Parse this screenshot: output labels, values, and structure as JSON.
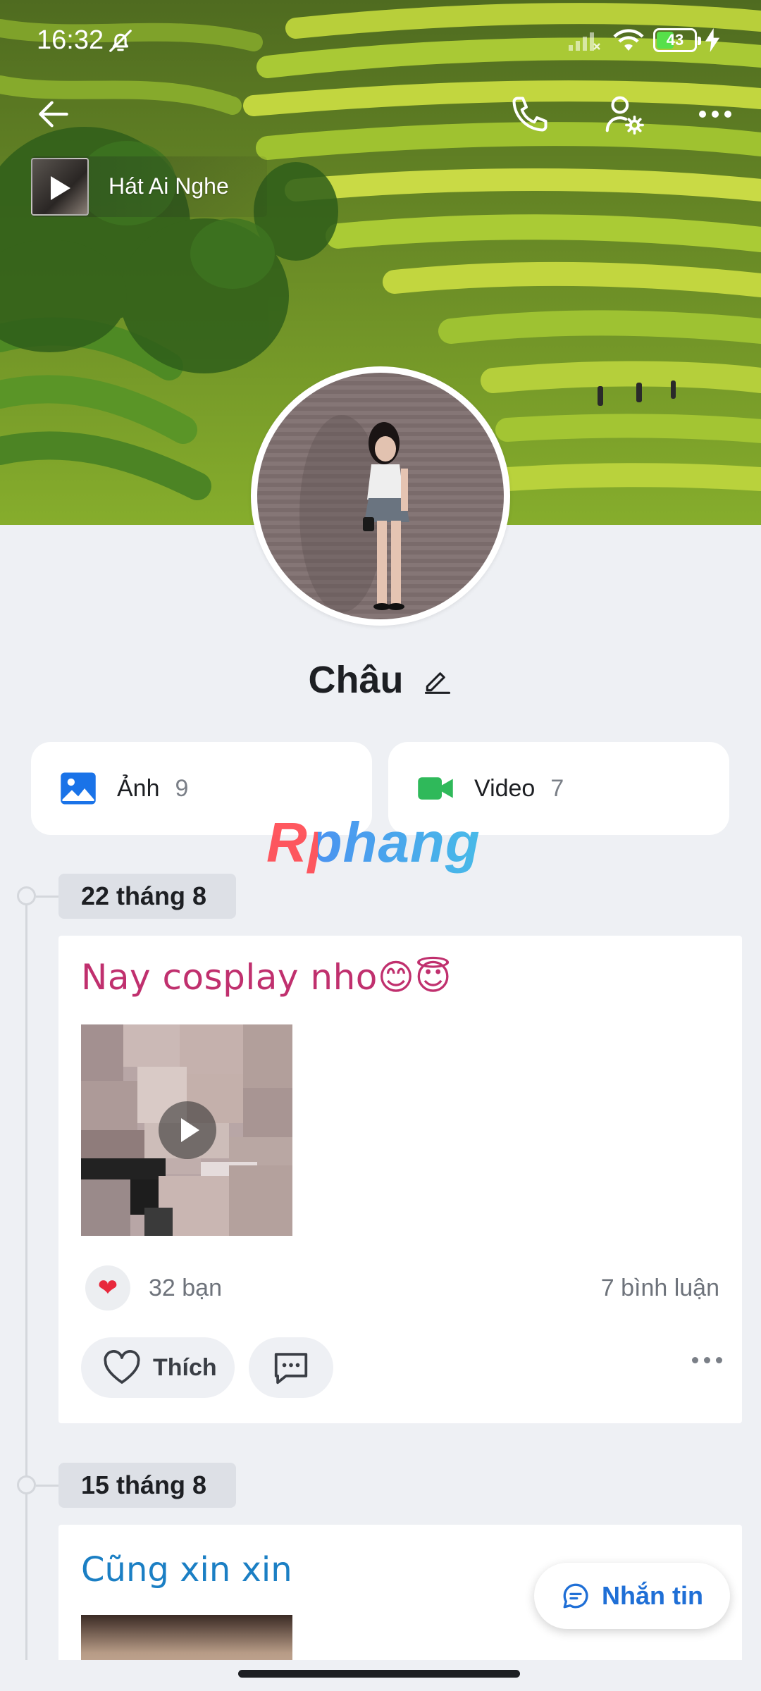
{
  "status_bar": {
    "time": "16:32",
    "battery_level": "43",
    "icons": [
      "bell-off-icon",
      "signal-icon",
      "wifi-icon",
      "battery-icon",
      "charging-icon"
    ]
  },
  "header": {
    "icons": [
      "back-arrow-icon",
      "phone-icon",
      "user-settings-icon",
      "more-horizontal-icon"
    ]
  },
  "music": {
    "title": "Hát Ai Nghe",
    "icon": "play-icon"
  },
  "profile": {
    "name": "Châu",
    "edit_icon": "pencil-icon"
  },
  "media": {
    "photos_label": "Ảnh",
    "photos_count": "9",
    "videos_label": "Video",
    "videos_count": "7"
  },
  "watermark": "Rphang",
  "timeline": [
    {
      "date": "22 tháng 8",
      "text": "Nay cosplay nho😊😇",
      "reactions": "32 bạn",
      "comments": "7 bình luận",
      "like_label": "Thích"
    },
    {
      "date": "15 tháng 8",
      "text": "Cũng xin xin"
    }
  ],
  "message_button": "Nhắn tin",
  "colors": {
    "accent": "#1f6fd6",
    "post1_text": "#c0306e",
    "post2_text": "#1b7fc4",
    "heart": "#e8283c",
    "video_icon": "#2fb95a",
    "photo_icon": "#1a73e8"
  }
}
